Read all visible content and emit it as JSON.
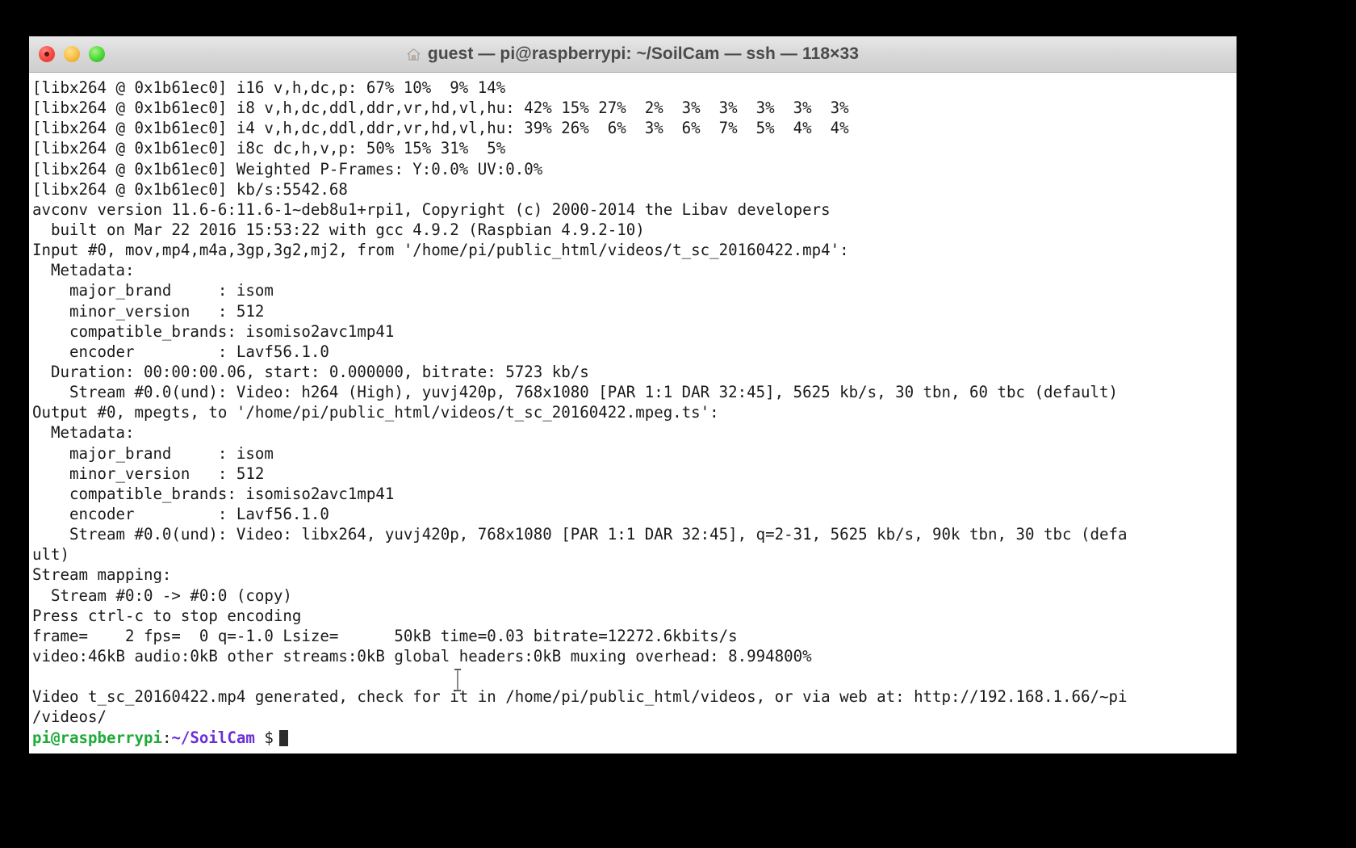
{
  "window": {
    "title": "guest — pi@raspberrypi: ~/SoilCam — ssh — 118×33",
    "home_icon": "home-icon",
    "controls": {
      "close_label": "close",
      "minimize_label": "minimize",
      "zoom_label": "zoom"
    },
    "colors": {
      "close": "#f5473f",
      "minimize": "#f7bd3f",
      "zoom": "#4bd637",
      "titlebar": "#d8d8d8",
      "background": "#ffffff",
      "foreground": "#1a1a1a",
      "prompt_user": "#1faa3a",
      "prompt_path": "#6b2fd6",
      "desktop": "#000000"
    }
  },
  "terminal": {
    "lines": [
      "[libx264 @ 0x1b61ec0] i16 v,h,dc,p: 67% 10%  9% 14%",
      "[libx264 @ 0x1b61ec0] i8 v,h,dc,ddl,ddr,vr,hd,vl,hu: 42% 15% 27%  2%  3%  3%  3%  3%  3%",
      "[libx264 @ 0x1b61ec0] i4 v,h,dc,ddl,ddr,vr,hd,vl,hu: 39% 26%  6%  3%  6%  7%  5%  4%  4%",
      "[libx264 @ 0x1b61ec0] i8c dc,h,v,p: 50% 15% 31%  5%",
      "[libx264 @ 0x1b61ec0] Weighted P-Frames: Y:0.0% UV:0.0%",
      "[libx264 @ 0x1b61ec0] kb/s:5542.68",
      "avconv version 11.6-6:11.6-1~deb8u1+rpi1, Copyright (c) 2000-2014 the Libav developers",
      "  built on Mar 22 2016 15:53:22 with gcc 4.9.2 (Raspbian 4.9.2-10)",
      "Input #0, mov,mp4,m4a,3gp,3g2,mj2, from '/home/pi/public_html/videos/t_sc_20160422.mp4':",
      "  Metadata:",
      "    major_brand     : isom",
      "    minor_version   : 512",
      "    compatible_brands: isomiso2avc1mp41",
      "    encoder         : Lavf56.1.0",
      "  Duration: 00:00:00.06, start: 0.000000, bitrate: 5723 kb/s",
      "    Stream #0.0(und): Video: h264 (High), yuvj420p, 768x1080 [PAR 1:1 DAR 32:45], 5625 kb/s, 30 tbn, 60 tbc (default)",
      "Output #0, mpegts, to '/home/pi/public_html/videos/t_sc_20160422.mpeg.ts':",
      "  Metadata:",
      "    major_brand     : isom",
      "    minor_version   : 512",
      "    compatible_brands: isomiso2avc1mp41",
      "    encoder         : Lavf56.1.0",
      "    Stream #0.0(und): Video: libx264, yuvj420p, 768x1080 [PAR 1:1 DAR 32:45], q=2-31, 5625 kb/s, 90k tbn, 30 tbc (defa",
      "ult)",
      "Stream mapping:",
      "  Stream #0:0 -> #0:0 (copy)",
      "Press ctrl-c to stop encoding",
      "frame=    2 fps=  0 q=-1.0 Lsize=      50kB time=0.03 bitrate=12272.6kbits/s",
      "video:46kB audio:0kB other streams:0kB global headers:0kB muxing overhead: 8.994800%",
      "",
      "Video t_sc_20160422.mp4 generated, check for it in /home/pi/public_html/videos, or via web at: http://192.168.1.66/~pi",
      "/videos/"
    ],
    "prompt": {
      "user_host": "pi@raspberrypi",
      "colon": ":",
      "path": "~/SoilCam",
      "symbol": " $",
      "cursor": "block-cursor"
    }
  },
  "mouse": {
    "cursor_type": "text-ibeam"
  }
}
